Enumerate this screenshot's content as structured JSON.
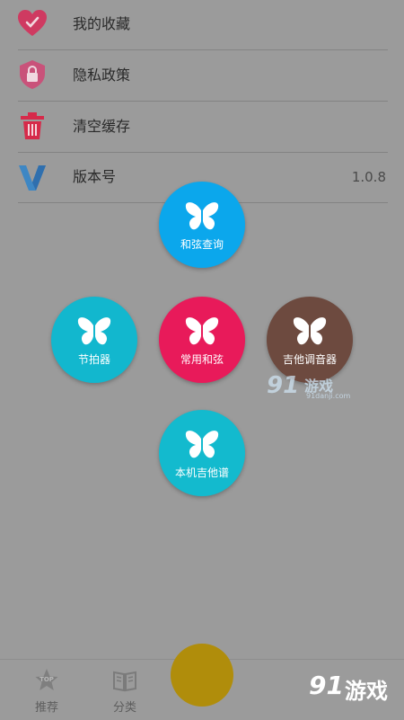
{
  "settings": {
    "items": [
      {
        "label": "我的收藏",
        "icon": "favorite-heart-icon"
      },
      {
        "label": "隐私政策",
        "icon": "privacy-shield-icon"
      },
      {
        "label": "清空缓存",
        "icon": "trash-icon"
      },
      {
        "label": "版本号",
        "icon": "version-v-icon",
        "value": "1.0.8"
      }
    ]
  },
  "menu": {
    "items": [
      {
        "label": "和弦查询",
        "color": "#0ba7ec",
        "icon": "butterfly-icon"
      },
      {
        "label": "节拍器",
        "color": "#12b7ce",
        "icon": "butterfly-icon"
      },
      {
        "label": "常用和弦",
        "color": "#e81a5a",
        "icon": "butterfly-icon"
      },
      {
        "label": "吉他调音器",
        "color": "#6d4a3f",
        "icon": "butterfly-icon"
      },
      {
        "label": "本机吉他谱",
        "color": "#13bace",
        "icon": "butterfly-icon"
      }
    ]
  },
  "watermark": {
    "mid_number": "91",
    "mid_text": "游戏",
    "mid_sub": "91danji.com",
    "bottom_number": "91",
    "bottom_text": "游戏"
  },
  "nav": {
    "tabs": [
      {
        "label": "推荐",
        "icon": "top-star-icon"
      },
      {
        "label": "分类",
        "icon": "book-icon"
      }
    ],
    "fab_color": "#b08d0b"
  }
}
